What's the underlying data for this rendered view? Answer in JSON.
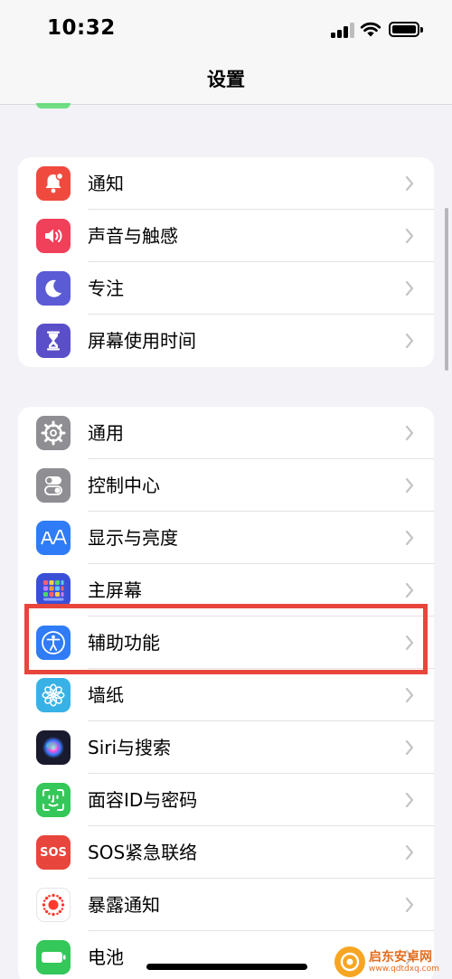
{
  "status_bar": {
    "time": "10:32"
  },
  "nav": {
    "title": "设置"
  },
  "groups": [
    {
      "items": [
        {
          "label": "通知",
          "icon": "notification-bell-icon",
          "color": "#f04a3f"
        },
        {
          "label": "声音与触感",
          "icon": "speaker-icon",
          "color": "#f0405a"
        },
        {
          "label": "专注",
          "icon": "moon-icon",
          "color": "#5b5bd6"
        },
        {
          "label": "屏幕使用时间",
          "icon": "hourglass-icon",
          "color": "#5b4fc9"
        }
      ]
    },
    {
      "items": [
        {
          "label": "通用",
          "icon": "gear-icon",
          "color": "#8e8e93"
        },
        {
          "label": "控制中心",
          "icon": "toggle-switches-icon",
          "color": "#8e8e93"
        },
        {
          "label": "显示与亮度",
          "icon": "text-size-aa-icon",
          "color": "#2f7cf6"
        },
        {
          "label": "主屏幕",
          "icon": "app-grid-icon",
          "color": "#3a4fd8"
        },
        {
          "label": "辅助功能",
          "icon": "accessibility-person-icon",
          "color": "#2f7cf6"
        },
        {
          "label": "墙纸",
          "icon": "flower-icon",
          "color": "#38b2e6"
        },
        {
          "label": "Siri与搜索",
          "icon": "siri-orb-icon",
          "color": "#1a1a2e"
        },
        {
          "label": "面容ID与密码",
          "icon": "face-id-icon",
          "color": "#34c759"
        },
        {
          "label": "SOS紧急联络",
          "icon_text": "SOS",
          "icon": "sos-icon",
          "color": "#e8453c"
        },
        {
          "label": "暴露通知",
          "icon": "exposure-dots-icon",
          "color": "#ffffff"
        },
        {
          "label": "电池",
          "icon": "battery-icon",
          "color": "#34c759"
        }
      ]
    }
  ],
  "watermark": {
    "name": "启东安卓网",
    "url": "www.qdtdxq.com"
  },
  "highlight_color": "#e8453c"
}
